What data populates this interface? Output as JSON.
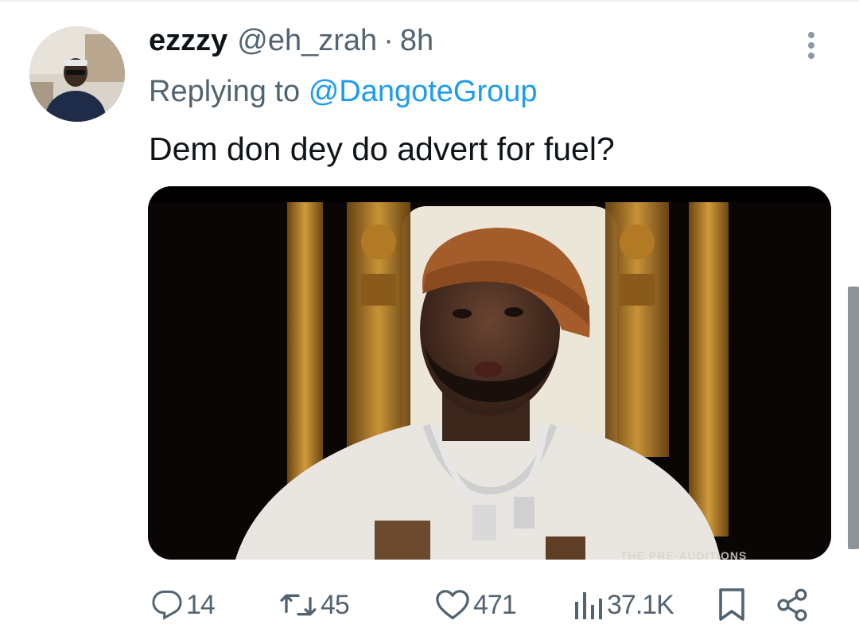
{
  "tweet": {
    "display_name": "ezzzy",
    "handle": "@eh_zrah",
    "separator": "·",
    "time": "8h",
    "replying_prefix": "Replying to",
    "replying_to": "@DangoteGroup",
    "text": "Dem don dey do advert for fuel?",
    "media_watermark": "THE PRE-AUDITIONS"
  },
  "actions": {
    "replies": "14",
    "reposts": "45",
    "likes": "471",
    "views": "37.1K"
  },
  "icons": {
    "more": "more-vertical-icon",
    "reply": "reply-icon",
    "repost": "repost-icon",
    "like": "heart-icon",
    "views": "views-bar-chart-icon",
    "bookmark": "bookmark-icon",
    "share": "share-icon"
  },
  "colors": {
    "text_primary": "#0f1419",
    "text_secondary": "#536471",
    "link": "#1d9bf0"
  }
}
